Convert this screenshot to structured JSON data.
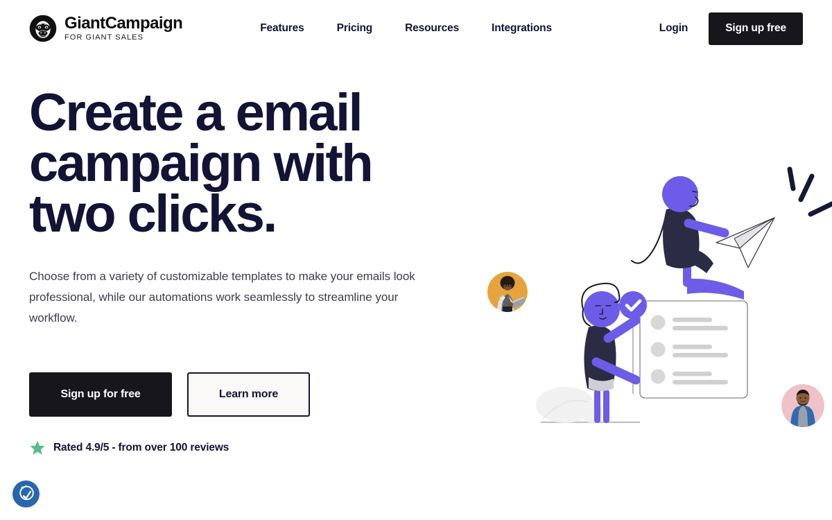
{
  "brand": {
    "name": "GiantCampaign",
    "tagline": "FOR GIANT SALES",
    "logo_icon": "gorilla-head-icon"
  },
  "nav": {
    "items": [
      {
        "label": "Features"
      },
      {
        "label": "Pricing"
      },
      {
        "label": "Resources"
      },
      {
        "label": "Integrations"
      }
    ],
    "login_label": "Login",
    "signup_label": "Sign up free"
  },
  "hero": {
    "headline": "Create a email campaign with two clicks.",
    "subhead": "Choose from a variety of customizable templates to make your emails look professional, while our automations work seamlessly to streamline your workflow.",
    "primary_cta": "Sign up for free",
    "secondary_cta": "Learn more",
    "rating_text": "Rated 4.9/5 - from over 100 reviews",
    "rating_icon": "star-icon"
  },
  "illustration": {
    "name": "email-campaign-illustration",
    "elements": [
      "person-with-paper-airplane",
      "person-pointing-at-list-card",
      "checkmark-badge",
      "list-card",
      "motion-dashes",
      "plant-bush",
      "avatar-photo-left",
      "avatar-photo-right"
    ]
  },
  "accessibility_widget": {
    "icon": "accessibility-icon",
    "label": "Accessibility options"
  },
  "colors": {
    "ink": "#131335",
    "button_dark": "#17171b",
    "accent_purple": "#6C5CE7",
    "star_green": "#5ABD8C",
    "a11y_blue": "#2866ae",
    "card_gray": "#d3d3d6"
  }
}
